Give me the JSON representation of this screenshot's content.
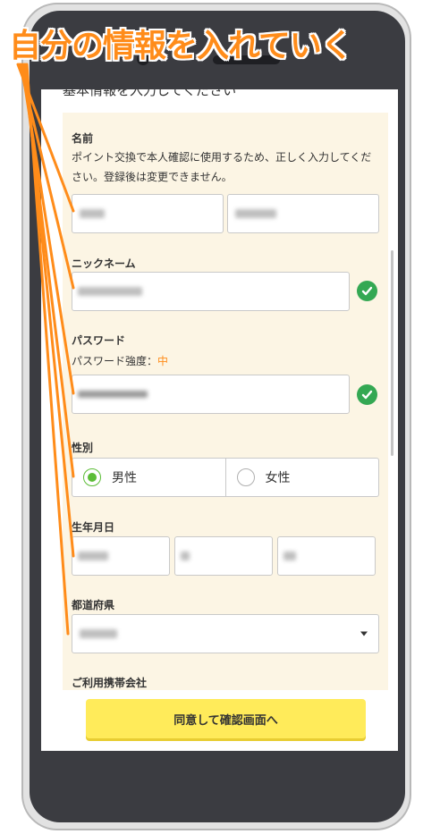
{
  "annotation": {
    "title": "自分の情報を入れていく"
  },
  "form": {
    "section_heading": "基本情報を入力してください",
    "name": {
      "label": "名前",
      "note": "ポイント交換で本人確認に使用するため、正しく入力してください。登録後は変更できません。"
    },
    "nickname": {
      "label": "ニックネーム"
    },
    "password": {
      "label": "パスワード",
      "strength_label": "パスワード強度：",
      "strength_value": "中",
      "strength_color": "#ff8c1a"
    },
    "gender": {
      "label": "性別",
      "options": [
        "男性",
        "女性"
      ],
      "selected": "男性"
    },
    "birthday": {
      "label": "生年月日"
    },
    "prefecture": {
      "label": "都道府県"
    },
    "carrier": {
      "label": "ご利用携帯会社"
    },
    "submit_label": "同意して確認画面へ"
  },
  "colors": {
    "accent": "#ff8c1a",
    "valid_check": "#34a853",
    "form_bg": "#fcf5e4",
    "submit_bg": "#ffeb5a"
  },
  "icons": [
    "check-circle-icon",
    "radio-checked-icon",
    "radio-unchecked-icon",
    "dropdown-caret-icon"
  ]
}
